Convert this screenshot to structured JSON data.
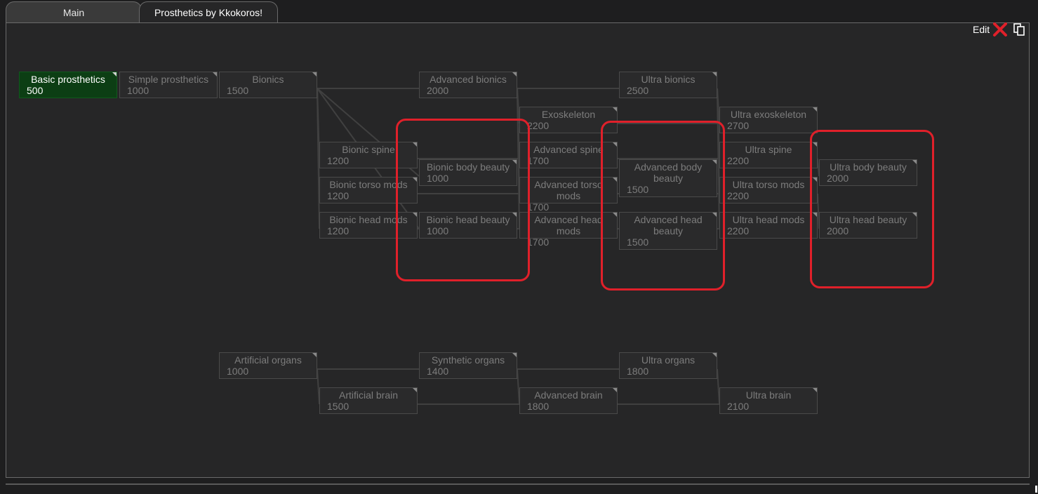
{
  "tabs": [
    {
      "label": "Main",
      "active": false
    },
    {
      "label": "Prosthetics by Kkokoros!",
      "active": true
    }
  ],
  "toolbar": {
    "edit_label": "Edit",
    "close_icon": "close-x-icon",
    "copy_icon": "copy-icon"
  },
  "colors": {
    "completed": "#0c3e14",
    "highlight": "#e0202a",
    "edge": "#404040"
  },
  "nodes": [
    {
      "id": "basic_prosthetics",
      "label": "Basic prosthetics",
      "cost": "500",
      "done": true
    },
    {
      "id": "simple_prosthetics",
      "label": "Simple prosthetics",
      "cost": "1000"
    },
    {
      "id": "bionics",
      "label": "Bionics",
      "cost": "1500"
    },
    {
      "id": "advanced_bionics",
      "label": "Advanced bionics",
      "cost": "2000"
    },
    {
      "id": "ultra_bionics",
      "label": "Ultra bionics",
      "cost": "2500"
    },
    {
      "id": "exoskeleton",
      "label": "Exoskeleton",
      "cost": "2200"
    },
    {
      "id": "ultra_exoskeleton",
      "label": "Ultra exoskeleton",
      "cost": "2700"
    },
    {
      "id": "bionic_spine",
      "label": "Bionic spine",
      "cost": "1200"
    },
    {
      "id": "bionic_torso_mods",
      "label": "Bionic torso mods",
      "cost": "1200"
    },
    {
      "id": "bionic_head_mods",
      "label": "Bionic head mods",
      "cost": "1200"
    },
    {
      "id": "bionic_body_beauty",
      "label": "Bionic body beauty",
      "cost": "1000"
    },
    {
      "id": "bionic_head_beauty",
      "label": "Bionic head beauty",
      "cost": "1000"
    },
    {
      "id": "advanced_spine",
      "label": "Advanced spine",
      "cost": "1700"
    },
    {
      "id": "advanced_torso_mods",
      "label": "Advanced torso mods",
      "cost": "1700"
    },
    {
      "id": "advanced_head_mods",
      "label": "Advanced head mods",
      "cost": "1700"
    },
    {
      "id": "advanced_body_beauty",
      "label": "Advanced body beauty",
      "cost": "1500"
    },
    {
      "id": "advanced_head_beauty",
      "label": "Advanced head beauty",
      "cost": "1500"
    },
    {
      "id": "ultra_spine",
      "label": "Ultra spine",
      "cost": "2200"
    },
    {
      "id": "ultra_torso_mods",
      "label": "Ultra torso mods",
      "cost": "2200"
    },
    {
      "id": "ultra_head_mods",
      "label": "Ultra head mods",
      "cost": "2200"
    },
    {
      "id": "ultra_body_beauty",
      "label": "Ultra body beauty",
      "cost": "2000"
    },
    {
      "id": "ultra_head_beauty",
      "label": "Ultra head beauty",
      "cost": "2000"
    },
    {
      "id": "artificial_organs",
      "label": "Artificial organs",
      "cost": "1000"
    },
    {
      "id": "artificial_brain",
      "label": "Artificial brain",
      "cost": "1500"
    },
    {
      "id": "synthetic_organs",
      "label": "Synthetic organs",
      "cost": "1400"
    },
    {
      "id": "advanced_brain",
      "label": "Advanced brain",
      "cost": "1800"
    },
    {
      "id": "ultra_organs",
      "label": "Ultra organs",
      "cost": "1800"
    },
    {
      "id": "ultra_brain",
      "label": "Ultra brain",
      "cost": "2100"
    }
  ]
}
